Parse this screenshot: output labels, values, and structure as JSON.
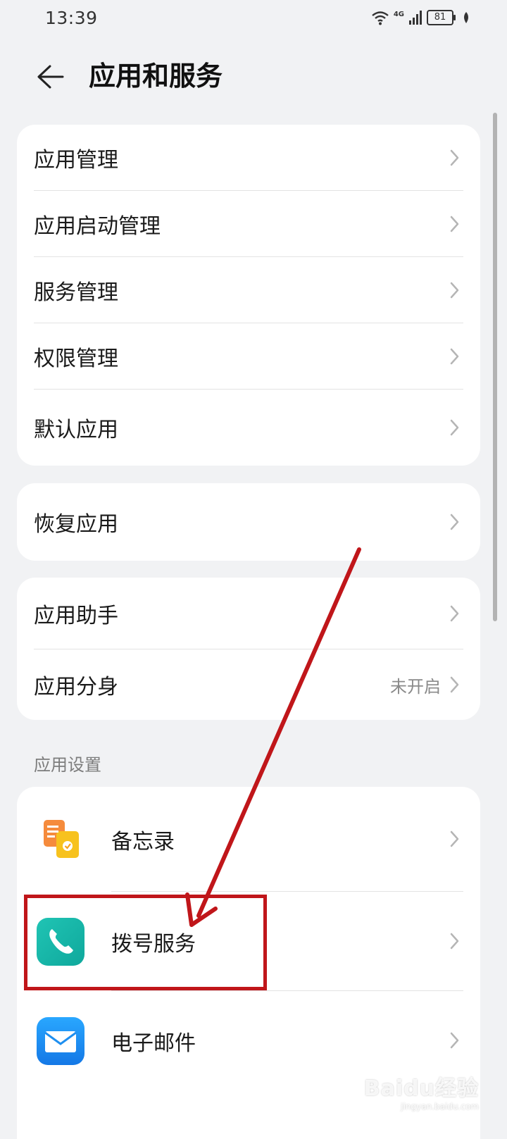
{
  "status_bar": {
    "time": "13:39",
    "network": "4G",
    "battery": "81"
  },
  "header": {
    "title": "应用和服务"
  },
  "group1": [
    {
      "label": "应用管理"
    },
    {
      "label": "应用启动管理"
    },
    {
      "label": "服务管理"
    },
    {
      "label": "权限管理"
    },
    {
      "label": "默认应用"
    }
  ],
  "group2": [
    {
      "label": "恢复应用"
    }
  ],
  "group3": [
    {
      "label": "应用助手"
    },
    {
      "label": "应用分身",
      "value": "未开启"
    }
  ],
  "app_settings": {
    "title": "应用设置",
    "items": [
      {
        "label": "备忘录",
        "icon": "memo-icon"
      },
      {
        "label": "拨号服务",
        "icon": "phone-icon"
      },
      {
        "label": "电子邮件",
        "icon": "email-icon"
      }
    ]
  },
  "watermark": {
    "text": "Baidu经验",
    "sub": "jingyan.baidu.com"
  },
  "colors": {
    "annotation": "#c0161a",
    "phone_icon": "#1bb3a9",
    "email_icon": "#1e8ff0",
    "memo_icon": "#f58b3c"
  }
}
